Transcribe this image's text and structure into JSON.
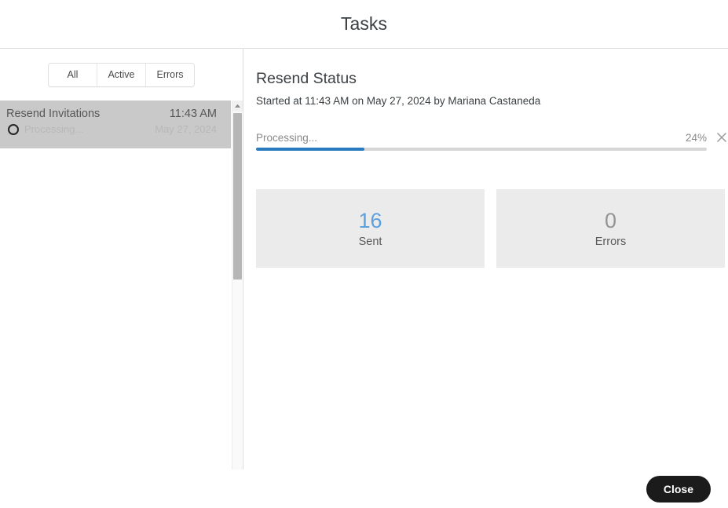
{
  "window": {
    "title": "Tasks"
  },
  "sidebar": {
    "filters": [
      {
        "label": "All",
        "selected": true
      },
      {
        "label": "Active",
        "selected": false
      },
      {
        "label": "Errors",
        "selected": false
      }
    ],
    "tasks": [
      {
        "title": "Resend Invitations",
        "status": "Processing...",
        "status_icon": "spinner-icon",
        "time": "11:43 AM",
        "date": "May 27, 2024",
        "selected": true
      }
    ],
    "scrollbar": {
      "up_arrow_icon": "chevron-up-icon"
    }
  },
  "detail": {
    "title": "Resend Status",
    "subtitle": "Started at 11:43 AM on May 27, 2024 by Mariana Castaneda",
    "progress": {
      "label": "Processing...",
      "percent_label": "24%",
      "percent_value": 24,
      "dismiss_icon": "close-x-icon",
      "fill_color": "#2a7ac0",
      "track_color": "#d6d6d6"
    },
    "stats": [
      {
        "value": "16",
        "label": "Sent",
        "color": "#5ba0dd"
      },
      {
        "value": "0",
        "label": "Errors",
        "color": "#949494"
      }
    ]
  },
  "footer": {
    "close_label": "Close"
  }
}
